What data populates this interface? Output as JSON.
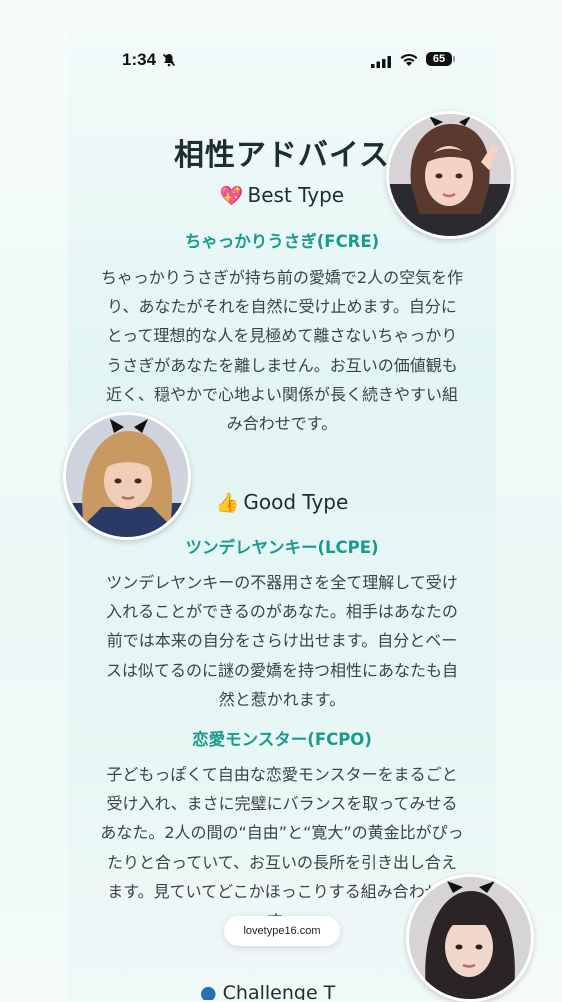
{
  "status": {
    "time": "1:34",
    "battery": "65"
  },
  "page": {
    "title": "相性アドバイス"
  },
  "best": {
    "emoji": "💖",
    "heading": "Best Type",
    "types": [
      {
        "name": "ちゃっかりうさぎ(FCRE)",
        "lines": [
          "ちゃっかりうさぎが持ち前の愛嬌で2人の空気を作",
          "り、あなたがそれを自然に受け止めます。自分に",
          "とって理想的な人を見極めて離さないちゃっかり",
          "うさぎがあなたを離しません。お互いの価値観も",
          "近く、穏やかで心地よい関係が長く続きやすい組",
          "み合わせです。"
        ]
      }
    ]
  },
  "good": {
    "emoji": "👍",
    "heading": "Good Type",
    "types": [
      {
        "name": "ツンデレヤンキー(LCPE)",
        "lines": [
          "ツンデレヤンキーの不器用さを全て理解して受け",
          "入れることができるのがあなた。相手はあなたの",
          "前では本来の自分をさらけ出せます。自分とベー",
          "スは似てるのに謎の愛嬌を持つ相性にあなたも自",
          "然と惹かれます。"
        ]
      },
      {
        "name": "恋愛モンスター(FCPO)",
        "lines": [
          "子どもっぽくて自由な恋愛モンスターをまるごと",
          "受け入れ、まさに完璧にバランスを取ってみせる",
          "あなた。2人の間の“自由”と“寛大”の黄金比がぴっ",
          "たりと合っていて、お互いの長所を引き出し合え",
          "ます。見ていてどこかほっこりする組み合わせで",
          "す。"
        ]
      }
    ]
  },
  "footer": {
    "site": "lovetype16.com",
    "next_heading_partial": "Challenge T"
  },
  "colors": {
    "accent": "#1a9a8e",
    "title": "#1f2d2d"
  }
}
